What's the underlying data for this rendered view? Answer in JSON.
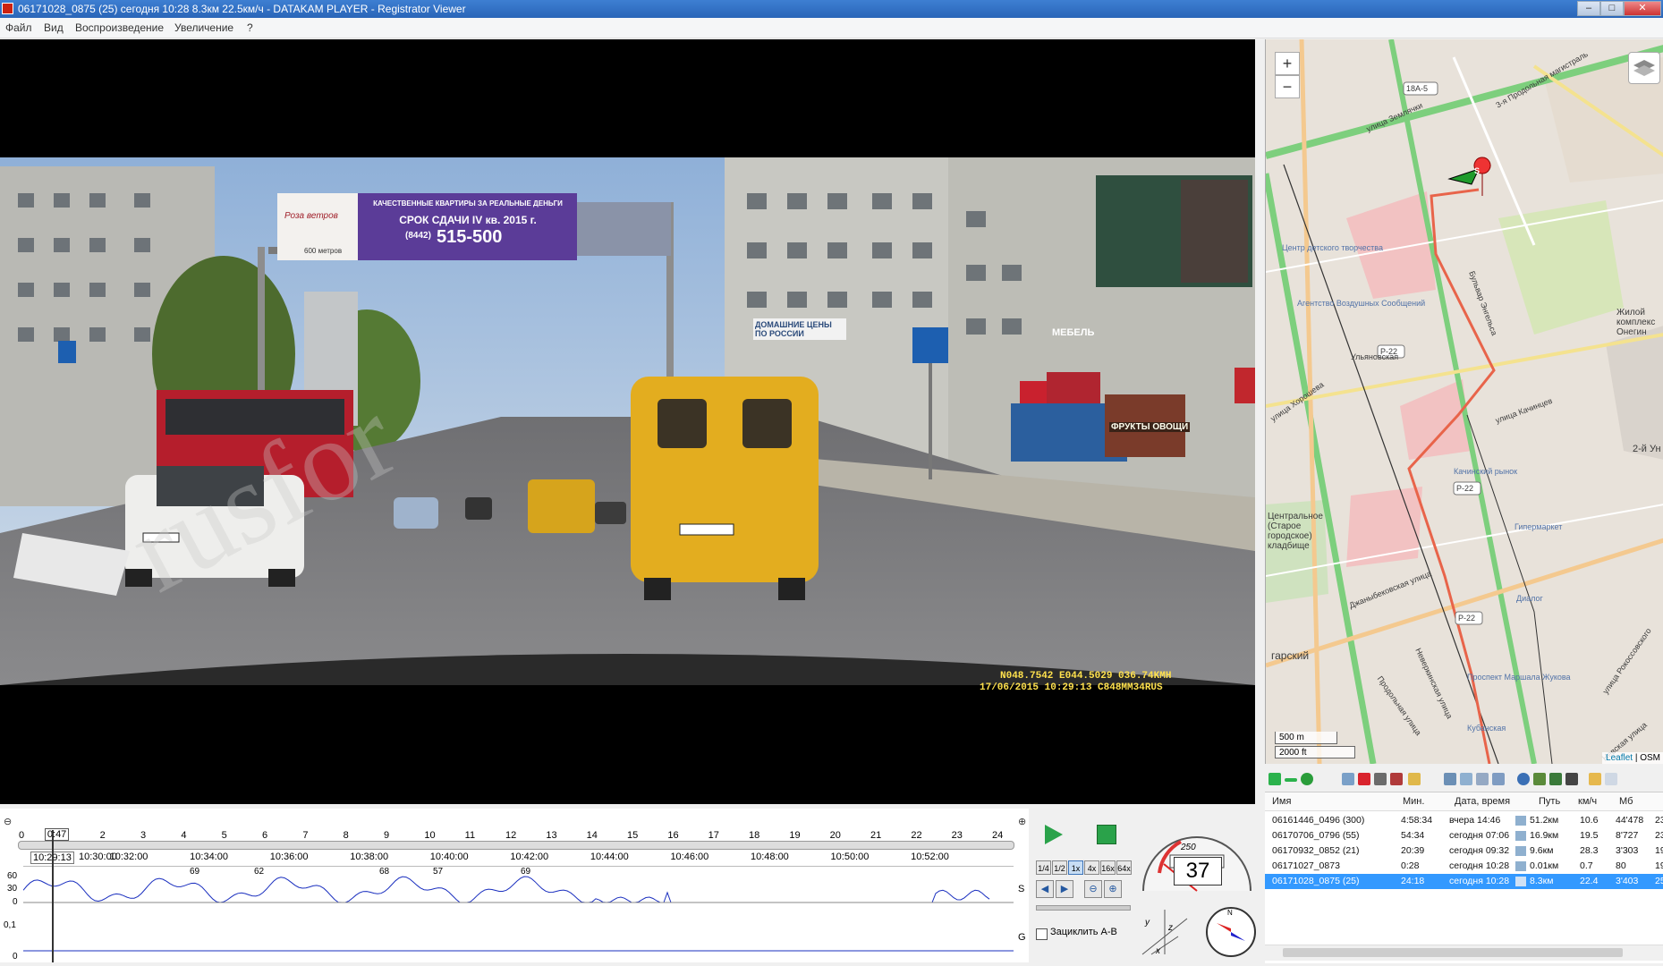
{
  "window": {
    "title": "06171028_0875 (25)      сегодня 10:28    8.3км    22.5км/ч  -  DATAKAM PLAYER - Registrator Viewer",
    "buttons": {
      "minimize": "–",
      "maximize": "□",
      "close": "✕"
    }
  },
  "menu": [
    "Файл",
    "Вид",
    "Воспроизведение",
    "Увеличение",
    "?"
  ],
  "video": {
    "osd_line1": "N048.7542 E044.5029 036.74KMH",
    "osd_line2": "17/06/2015  10:29:13  C848MM34RUS",
    "billboard": {
      "brand": "Роза ветров",
      "headline": "КАЧЕСТВЕННЫЕ КВАРТИРЫ ЗА РЕАЛЬНЫЕ ДЕНЬГИ",
      "deadline": "СРОК СДАЧИ IV кв. 2015 г.",
      "phone_code": "(8442)",
      "phone": "515-500",
      "distance": "600 метров"
    },
    "signs": {
      "furniture": "МЕБЕЛЬ",
      "fruits": "ФРУКТЫ ОВОЩИ",
      "homes": "ДОМАШНИЕ ЦЕНЫ ПО РОССИИ"
    }
  },
  "map": {
    "zoom_in": "+",
    "zoom_out": "−",
    "scale_m": "500 m",
    "scale_ft": "2000 ft",
    "attribution_link": "Leaflet",
    "attribution_sep": " | ",
    "attribution_osm": "OSM",
    "marker_label": "S",
    "labels": {
      "street1": "улица Землячки",
      "street2": "3-я Продольная магистраль",
      "street3": "Бульвар Энгельса",
      "street4": "улица Качинцев",
      "street5": "улица Хорошева",
      "street6": "Джаныбековская улица",
      "street7": "Продольная улица",
      "street8": "Неверкинская улица",
      "street9": "Невская улица",
      "street10": "улица Рокоссовского",
      "street11": "Ульяновская",
      "place1": "Центр детского творчества",
      "place2": "Агентство Воздушных Сообщений",
      "place3": "Жилой комплекс Онегин",
      "place4": "Центральное (Старое городское) кладбище",
      "place5": "Качинский рынок",
      "place6": "Гипермаркет",
      "place7": "Проспект Маршала Жукова",
      "place8": "Кубанская",
      "place9": "Диалог",
      "district": "гарский",
      "road1": "18А-5",
      "road2": "Р-22",
      "road3": "Р-22",
      "road4": "Р-22",
      "other": "2-й Ун"
    }
  },
  "filelist": {
    "columns": [
      "Имя",
      "Мин.",
      "Дата, время",
      "Путь",
      "км/ч",
      "Мб"
    ],
    "rows": [
      {
        "name": "06161446_0496 (300)",
        "min": "4:58:34",
        "date": "вчера 14:46",
        "path": "51.2км",
        "speed": "10.6",
        "mb": "44'478",
        "extra": "23"
      },
      {
        "name": "06170706_0796 (55)",
        "min": "54:34",
        "date": "сегодня 07:06",
        "path": "16.9км",
        "speed": "19.5",
        "mb": "8'727",
        "extra": "23"
      },
      {
        "name": "06170932_0852 (21)",
        "min": "20:39",
        "date": "сегодня 09:32",
        "path": "9.6км",
        "speed": "28.3",
        "mb": "3'303",
        "extra": "19"
      },
      {
        "name": "06171027_0873",
        "min": "0:28",
        "date": "сегодня 10:28",
        "path": "0.01км",
        "speed": "0.7",
        "mb": "80",
        "extra": "19"
      },
      {
        "name": "06171028_0875 (25)",
        "min": "24:18",
        "date": "сегодня 10:28",
        "path": "8.3км",
        "speed": "22.4",
        "mb": "3'403",
        "extra": "25",
        "selected": true
      }
    ]
  },
  "timeline": {
    "minutes": [
      "0",
      "1",
      "2",
      "3",
      "4",
      "5",
      "6",
      "7",
      "8",
      "9",
      "10",
      "11",
      "12",
      "13",
      "14",
      "15",
      "16",
      "17",
      "18",
      "19",
      "20",
      "21",
      "22",
      "23",
      "24"
    ],
    "current": "0:47",
    "current_fraction": 0.033,
    "start_time": "10:29:13",
    "times": [
      "10:30:00",
      "10:32:00",
      "10:34:00",
      "10:36:00",
      "10:38:00",
      "10:40:00",
      "10:42:00",
      "10:44:00",
      "10:46:00",
      "10:48:00",
      "10:50:00",
      "10:52:00"
    ],
    "speed_axis": [
      "60",
      "30",
      "0"
    ],
    "g_axis": [
      "0,1",
      "0"
    ],
    "speed_peaks": [
      "69",
      "62",
      "68",
      "57",
      "69"
    ],
    "speed_label": "S",
    "g_label": "G"
  },
  "controls": {
    "speeds": [
      "1/4",
      "1/2",
      "1x",
      "4x",
      "16x",
      "64x"
    ],
    "active_speed": "1x",
    "loop_label": "Зациклить А-В",
    "speedometer_value": "37",
    "speedometer_limit": "250",
    "gauge_ticks": [
      "20",
      "40",
      "60",
      "80",
      "100",
      "120",
      "140",
      "160",
      "180",
      "200"
    ],
    "axes": [
      "y",
      "z",
      "x"
    ],
    "compass": "N"
  },
  "colors": {
    "selection": "#3399ff",
    "route": "#e8644a",
    "osd": "#ffe14d",
    "speed_line": "#1a2fbf",
    "titlebar": "#2a65b8"
  }
}
